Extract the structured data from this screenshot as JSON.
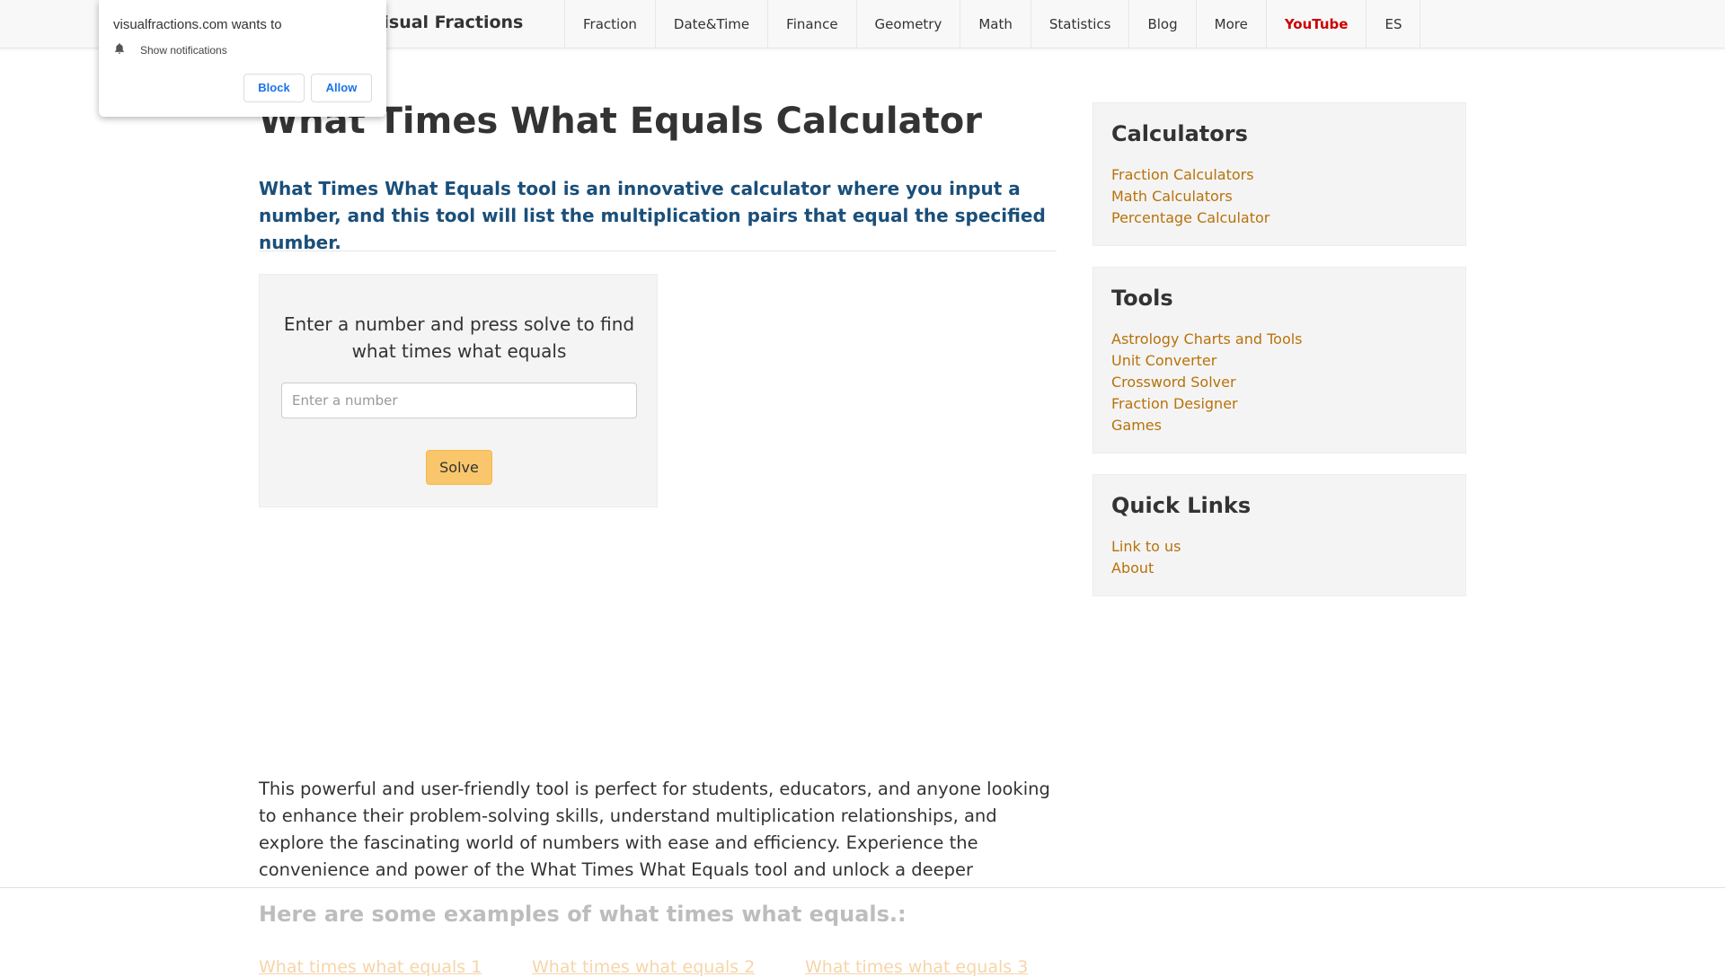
{
  "navbar": {
    "brand": "Visual Fractions",
    "items": [
      {
        "label": "Fraction"
      },
      {
        "label": "Date&Time"
      },
      {
        "label": "Finance"
      },
      {
        "label": "Geometry"
      },
      {
        "label": "Math"
      },
      {
        "label": "Statistics"
      },
      {
        "label": "Blog"
      },
      {
        "label": "More"
      },
      {
        "label": "YouTube",
        "color": "#cc0000"
      },
      {
        "label": "ES"
      }
    ]
  },
  "notification": {
    "title": "visualfractions.com wants to",
    "permission": "Show notifications",
    "block_label": "Block",
    "allow_label": "Allow",
    "icon": "bell-icon"
  },
  "main": {
    "title": "What Times What Equals Calculator",
    "lead": "What Times What Equals tool is an innovative calculator where you input a number, and this tool will list the multiplication pairs that equal the specified number.",
    "calculator": {
      "prompt": "Enter a number and press solve to find what times what equals",
      "input_value": "",
      "input_placeholder": "Enter a number",
      "solve_label": "Solve"
    },
    "body": "This powerful and user-friendly tool is perfect for students, educators, and anyone looking to enhance their problem-solving skills, understand multiplication relationships, and explore the fascinating world of numbers with ease and efficiency. Experience the convenience and power of the What Times What Equals tool and unlock a deeper understanding of mathematics.",
    "examples_title": "Here are some examples of what times what equals.:",
    "examples": [
      {
        "label": "What times what equals 1"
      },
      {
        "label": "What times what equals 2"
      },
      {
        "label": "What times what equals 3"
      }
    ]
  },
  "sidebar": {
    "calculators": {
      "title": "Calculators",
      "links": [
        "Fraction Calculators",
        "Math Calculators",
        "Percentage Calculator"
      ]
    },
    "tools": {
      "title": "Tools",
      "links": [
        "Astrology Charts and Tools",
        "Unit Converter",
        "Crossword Solver",
        "Fraction Designer",
        "Games"
      ]
    },
    "quick_links": {
      "title": "Quick Links",
      "links": [
        "Link to us",
        "About"
      ]
    }
  },
  "colors": {
    "accent_link": "#b8720a",
    "lead_text": "#1a4f7a",
    "solve_button": "#f9c66b",
    "youtube": "#cc0000"
  }
}
